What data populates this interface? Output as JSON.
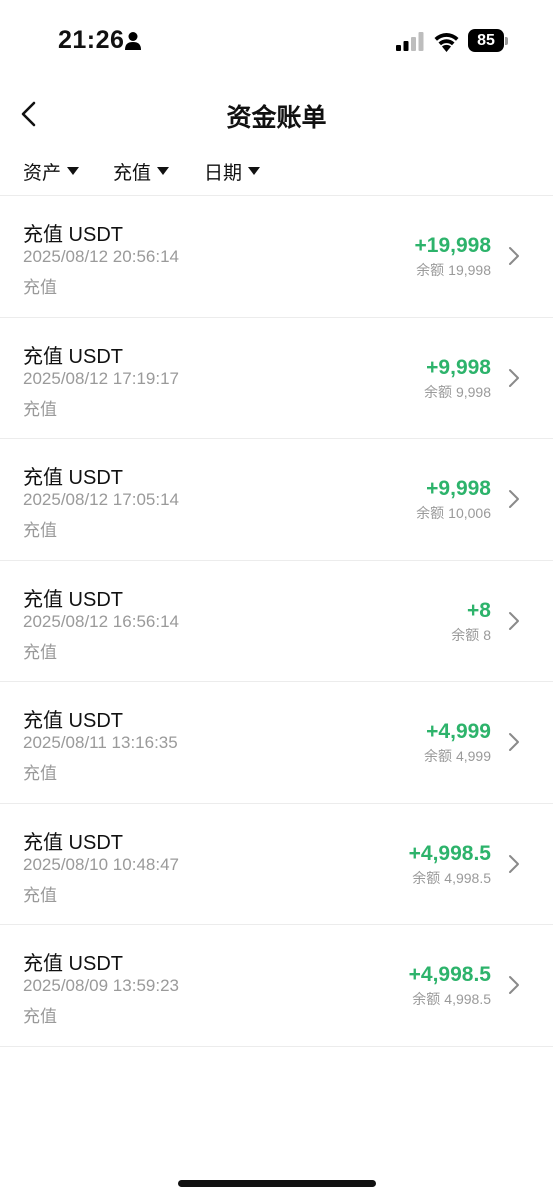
{
  "status_bar": {
    "time": "21:26",
    "battery": "85"
  },
  "nav": {
    "title": "资金账单"
  },
  "filters": [
    {
      "label": "资产"
    },
    {
      "label": "充值"
    },
    {
      "label": "日期"
    }
  ],
  "balance_label": "余额",
  "records": [
    {
      "title": "充值 USDT",
      "time": "2025/08/12 20:56:14",
      "type": "充值",
      "amount": "+19,998",
      "balance": "19,998"
    },
    {
      "title": "充值 USDT",
      "time": "2025/08/12 17:19:17",
      "type": "充值",
      "amount": "+9,998",
      "balance": "9,998"
    },
    {
      "title": "充值 USDT",
      "time": "2025/08/12 17:05:14",
      "type": "充值",
      "amount": "+9,998",
      "balance": "10,006"
    },
    {
      "title": "充值 USDT",
      "time": "2025/08/12 16:56:14",
      "type": "充值",
      "amount": "+8",
      "balance": "8"
    },
    {
      "title": "充值 USDT",
      "time": "2025/08/11 13:16:35",
      "type": "充值",
      "amount": "+4,999",
      "balance": "4,999"
    },
    {
      "title": "充值 USDT",
      "time": "2025/08/10 10:48:47",
      "type": "充值",
      "amount": "+4,998.5",
      "balance": "4,998.5"
    },
    {
      "title": "充值 USDT",
      "time": "2025/08/09 13:59:23",
      "type": "充值",
      "amount": "+4,998.5",
      "balance": "4,998.5"
    }
  ],
  "colors": {
    "positive": "#2db36b",
    "muted": "#9a9a9a",
    "divider": "#ececec"
  }
}
